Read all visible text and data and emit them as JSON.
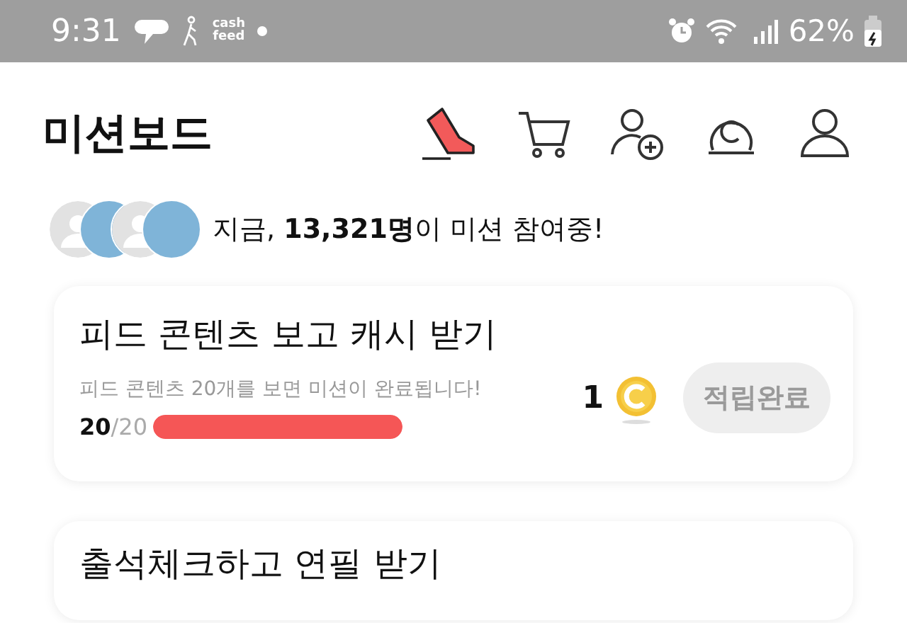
{
  "status_bar": {
    "time": "9:31",
    "app_label": "cash feed",
    "battery": "62%"
  },
  "header": {
    "title": "미션보드"
  },
  "participants": {
    "avatars": [
      {
        "kind": "placeholder"
      },
      {
        "kind": "photo"
      },
      {
        "kind": "placeholder"
      },
      {
        "kind": "photo"
      }
    ],
    "text": "지금, **13,321명**이 미션 참여중!"
  },
  "missions": [
    {
      "title": "피드 콘텐츠 보고 캐시 받기",
      "description": "피드 콘텐츠 20개를 보면 미션이 완료됩니다!",
      "reward": "1",
      "progress_done": "20",
      "progress_total": "/20",
      "level": 1,
      "button": "적립완료",
      "disabled": true
    },
    {
      "title": "출석체크하고 연필 받기"
    }
  ]
}
